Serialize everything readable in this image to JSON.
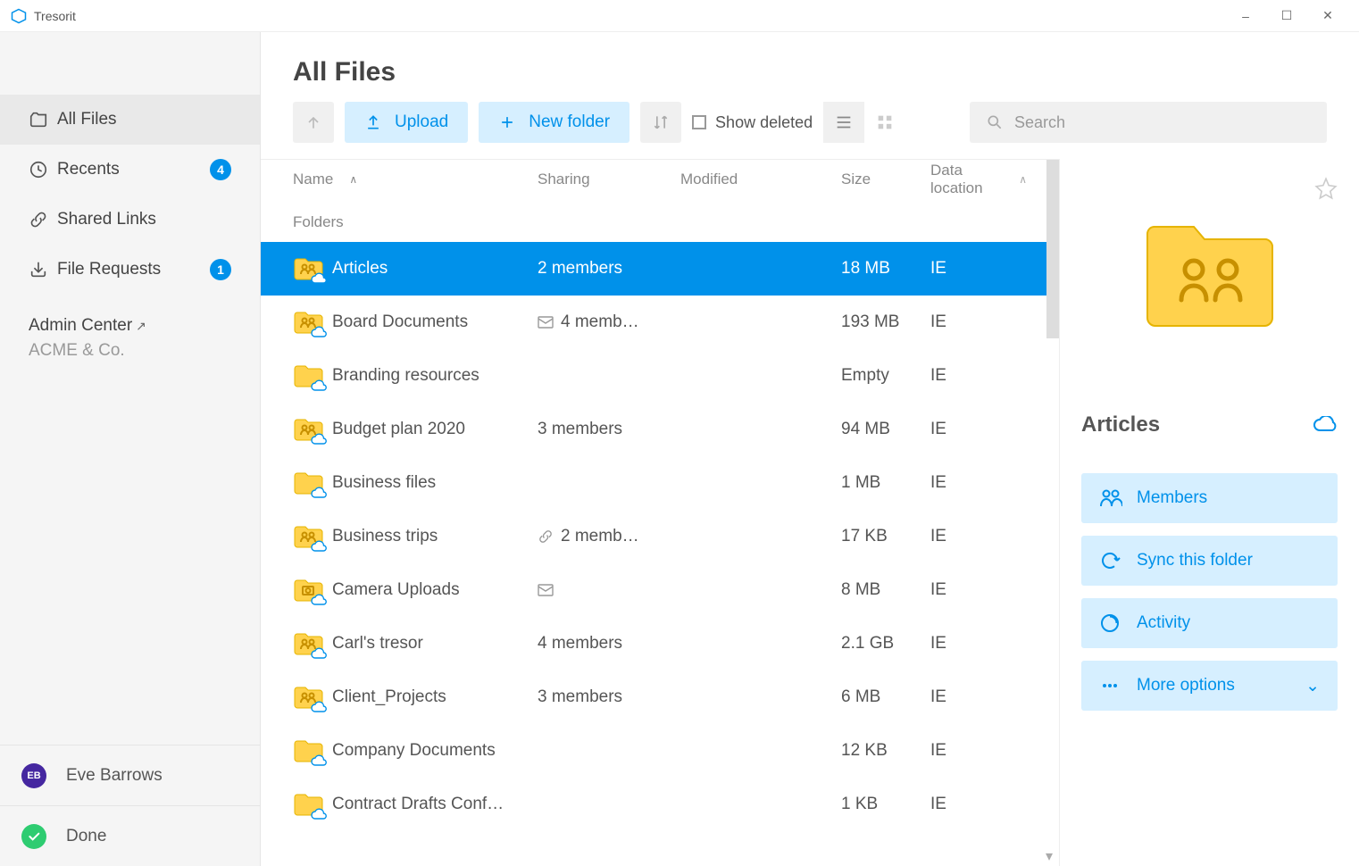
{
  "app": {
    "title": "Tresorit"
  },
  "windowButtons": {
    "min": "–",
    "max": "☐",
    "close": "✕"
  },
  "sidebar": {
    "items": [
      {
        "label": "All Files",
        "badge": null,
        "active": true
      },
      {
        "label": "Recents",
        "badge": "4",
        "active": false
      },
      {
        "label": "Shared Links",
        "badge": null,
        "active": false
      },
      {
        "label": "File Requests",
        "badge": "1",
        "active": false
      }
    ],
    "adminCenter": "Admin Center",
    "org": "ACME & Co."
  },
  "user": {
    "initials": "EB",
    "name": "Eve Barrows"
  },
  "status": {
    "label": "Done"
  },
  "page": {
    "title": "All Files",
    "toolbar": {
      "upload": "Upload",
      "newFolder": "New folder",
      "showDeleted": "Show deleted",
      "searchPlaceholder": "Search"
    },
    "columns": {
      "name": "Name",
      "sharing": "Sharing",
      "modified": "Modified",
      "size": "Size",
      "location": "Data location"
    },
    "groupHeader": "Folders"
  },
  "files": [
    {
      "name": "Articles",
      "sharing": "2 members",
      "shareIcon": null,
      "modified": "",
      "size": "18 MB",
      "location": "IE",
      "shared": true,
      "selected": true
    },
    {
      "name": "Board Documents",
      "sharing": "4 memb…",
      "shareIcon": "mail",
      "modified": "",
      "size": "193 MB",
      "location": "IE",
      "shared": true,
      "selected": false
    },
    {
      "name": "Branding resources",
      "sharing": "",
      "shareIcon": null,
      "modified": "",
      "size": "Empty",
      "location": "IE",
      "shared": false,
      "selected": false
    },
    {
      "name": "Budget plan 2020",
      "sharing": "3 members",
      "shareIcon": null,
      "modified": "",
      "size": "94 MB",
      "location": "IE",
      "shared": true,
      "selected": false
    },
    {
      "name": "Business files",
      "sharing": "",
      "shareIcon": null,
      "modified": "",
      "size": "1 MB",
      "location": "IE",
      "shared": false,
      "selected": false
    },
    {
      "name": "Business trips",
      "sharing": "2 memb…",
      "shareIcon": "link",
      "modified": "",
      "size": "17 KB",
      "location": "IE",
      "shared": true,
      "selected": false
    },
    {
      "name": "Camera Uploads",
      "sharing": "",
      "shareIcon": "mail",
      "modified": "",
      "size": "8 MB",
      "location": "IE",
      "shared": false,
      "special": "camera",
      "selected": false
    },
    {
      "name": "Carl's tresor",
      "sharing": "4 members",
      "shareIcon": null,
      "modified": "",
      "size": "2.1 GB",
      "location": "IE",
      "shared": true,
      "selected": false
    },
    {
      "name": "Client_Projects",
      "sharing": "3 members",
      "shareIcon": null,
      "modified": "",
      "size": "6 MB",
      "location": "IE",
      "shared": true,
      "selected": false
    },
    {
      "name": "Company Documents",
      "sharing": "",
      "shareIcon": null,
      "modified": "",
      "size": "12 KB",
      "location": "IE",
      "shared": false,
      "selected": false
    },
    {
      "name": "Contract Drafts Conf…",
      "sharing": "",
      "shareIcon": null,
      "modified": "",
      "size": "1 KB",
      "location": "IE",
      "shared": false,
      "selected": false
    }
  ],
  "details": {
    "title": "Articles",
    "buttons": [
      {
        "label": "Members",
        "icon": "members"
      },
      {
        "label": "Sync this folder",
        "icon": "sync"
      },
      {
        "label": "Activity",
        "icon": "activity"
      },
      {
        "label": "More options",
        "icon": "more",
        "chevron": true
      }
    ]
  }
}
